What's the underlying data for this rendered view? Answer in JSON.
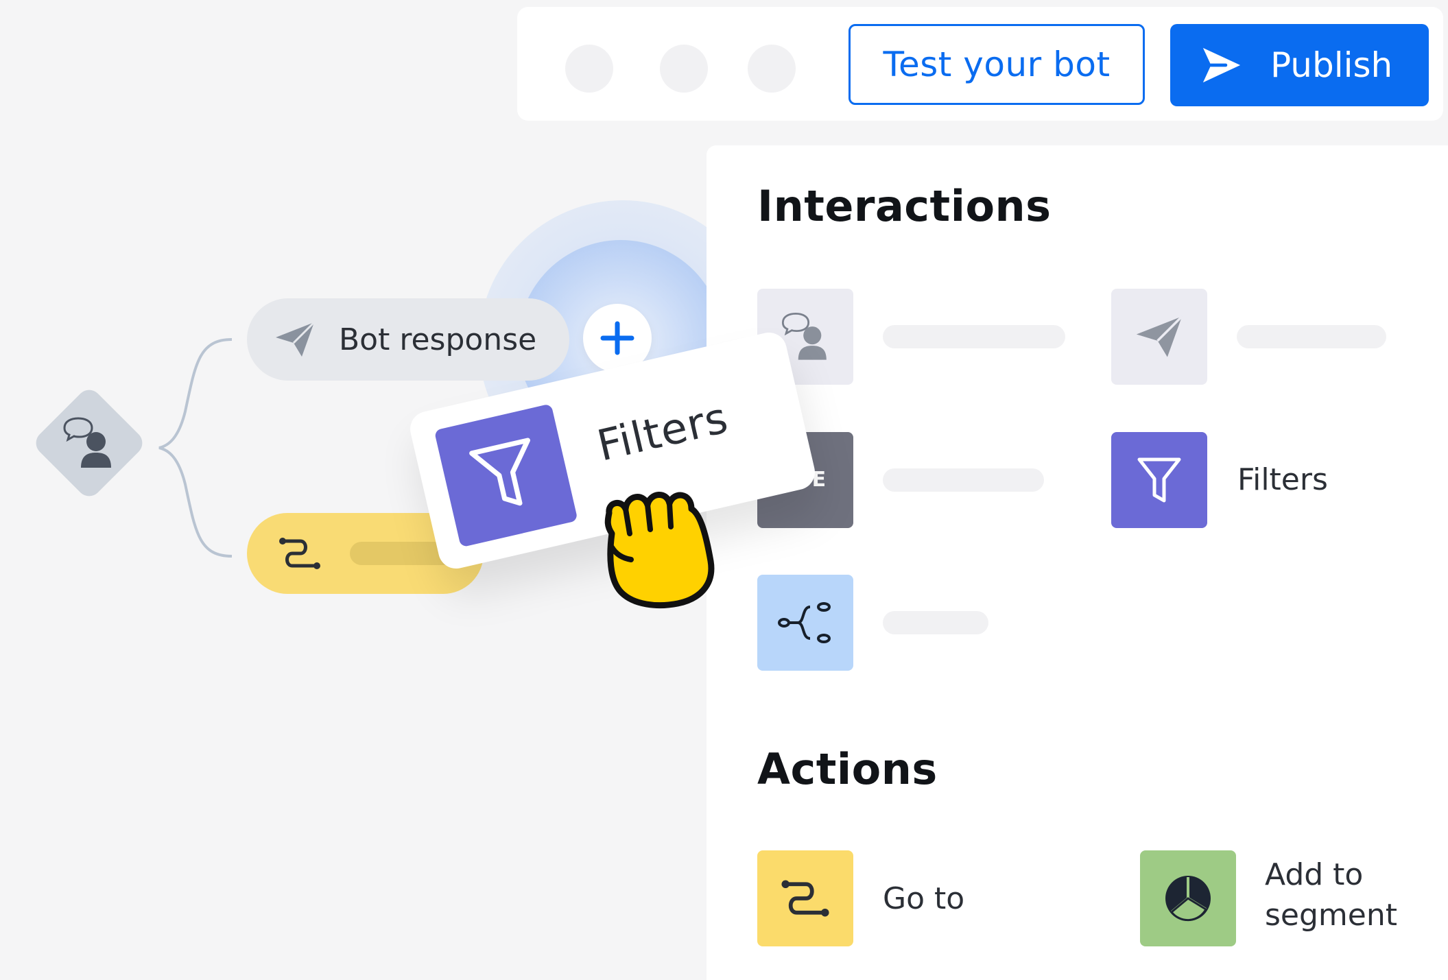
{
  "toolbar": {
    "test_label": "Test your bot",
    "publish_label": "Publish"
  },
  "canvas": {
    "bot_response_label": "Bot response",
    "dragged_card_label": "Filters"
  },
  "interactions": {
    "title": "Interactions",
    "filters_label": "Filters",
    "partial_tile_text": "SE"
  },
  "actions": {
    "title": "Actions",
    "goto_label": "Go to",
    "segment_label_line1": "Add to",
    "segment_label_line2": "segment"
  },
  "colors": {
    "primary": "#0a6cf0",
    "filters_purple": "#6b6ad6",
    "goto_yellow": "#fbdb6b",
    "segment_green": "#9ecb85",
    "split_blue": "#b8d6fa"
  }
}
